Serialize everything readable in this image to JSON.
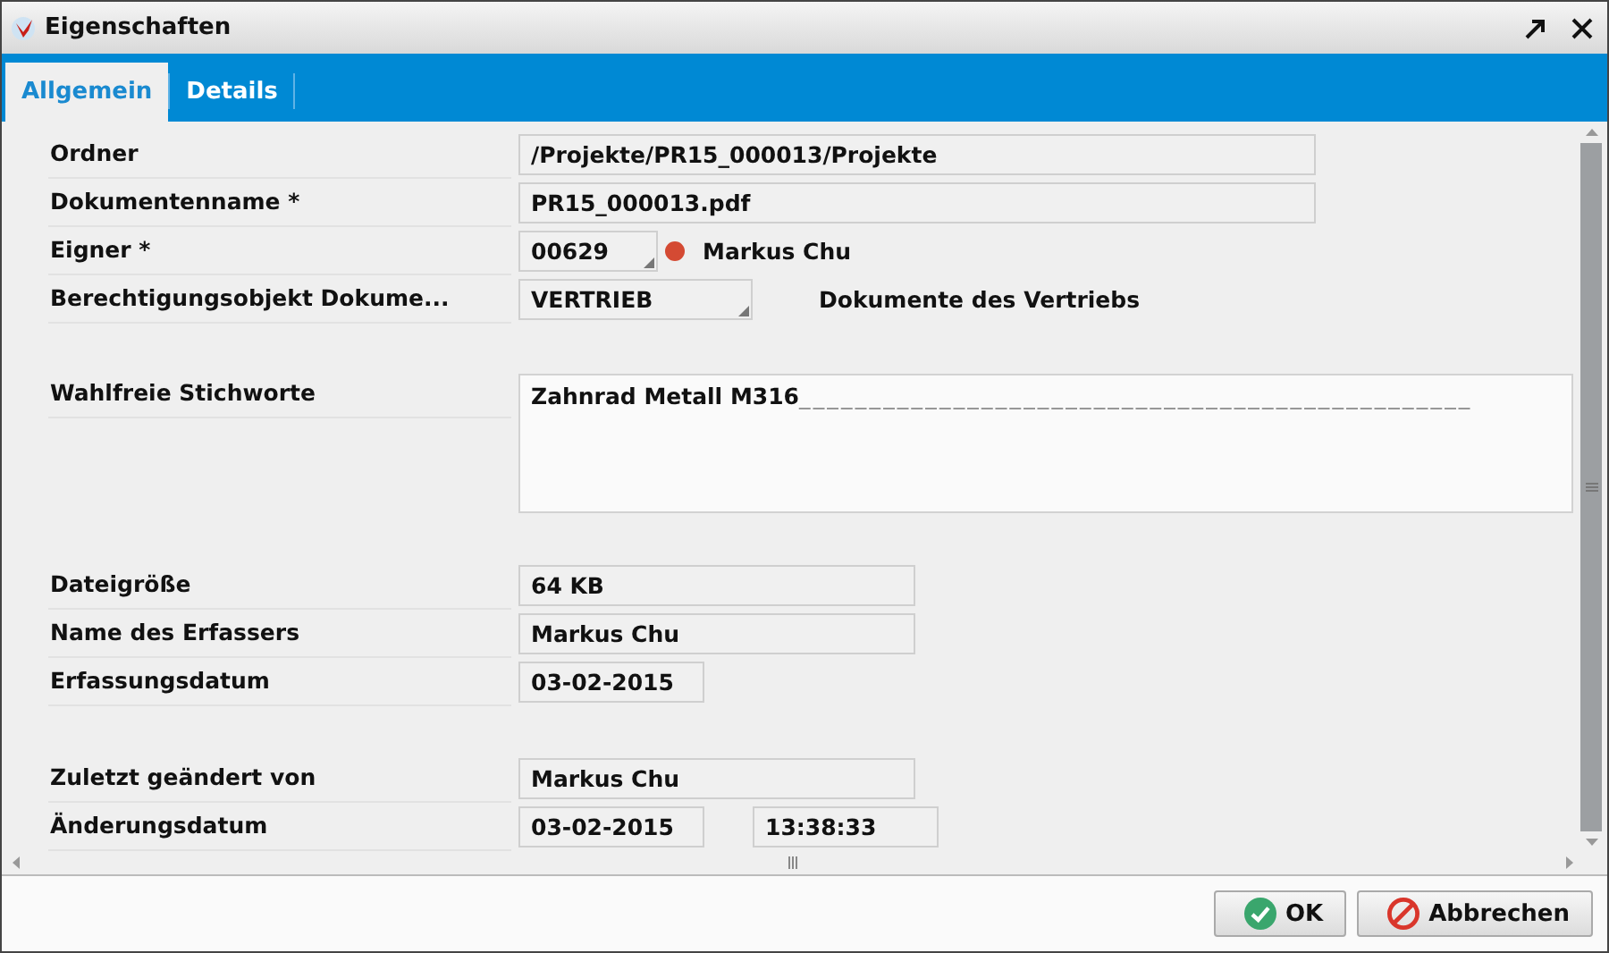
{
  "window": {
    "title": "Eigenschaften"
  },
  "tabs": [
    {
      "label": "Allgemein",
      "selected": true
    },
    {
      "label": "Details",
      "selected": false
    }
  ],
  "sections": [
    [
      {
        "label": "Ordner",
        "fields": [
          {
            "value": "/Projekte/PR15_000013/Projekte",
            "dropdown": false
          }
        ]
      },
      {
        "label": "Dokumentenname *",
        "fields": [
          {
            "value": "PR15_000013.pdf",
            "dropdown": false
          }
        ]
      },
      {
        "label": "Eigner *",
        "fields": [
          {
            "value": "00629",
            "dropdown": true
          }
        ],
        "status_dot": true,
        "description": "Markus Chu"
      },
      {
        "label": "Berechtigungsobjekt Dokume...",
        "fields": [
          {
            "value": "VERTRIEB",
            "dropdown": true
          }
        ],
        "description": "Dokumente des Vertriebs"
      }
    ],
    [
      {
        "label": "Wahlfreie Stichworte",
        "textarea": {
          "value": "Zahnrad Metall M316",
          "trailing": "________________________________________________"
        }
      }
    ],
    [
      {
        "label": "Dateigröße",
        "fields": [
          {
            "value": "64 KB",
            "dropdown": false
          }
        ]
      },
      {
        "label": "Name des Erfassers",
        "fields": [
          {
            "value": "Markus Chu",
            "dropdown": false
          }
        ]
      },
      {
        "label": "Erfassungsdatum",
        "fields": [
          {
            "value": "03-02-2015",
            "dropdown": false
          }
        ]
      }
    ],
    [
      {
        "label": "Zuletzt geändert von",
        "fields": [
          {
            "value": "Markus Chu",
            "dropdown": false
          }
        ]
      },
      {
        "label": "Änderungsdatum",
        "fields": [
          {
            "value": "03-02-2015",
            "dropdown": false
          },
          {
            "value": "13:38:33",
            "dropdown": false
          }
        ]
      }
    ]
  ],
  "buttons": [
    {
      "label": "OK",
      "kind": "ok"
    },
    {
      "label": "Abbrechen",
      "kind": "cancel"
    }
  ]
}
